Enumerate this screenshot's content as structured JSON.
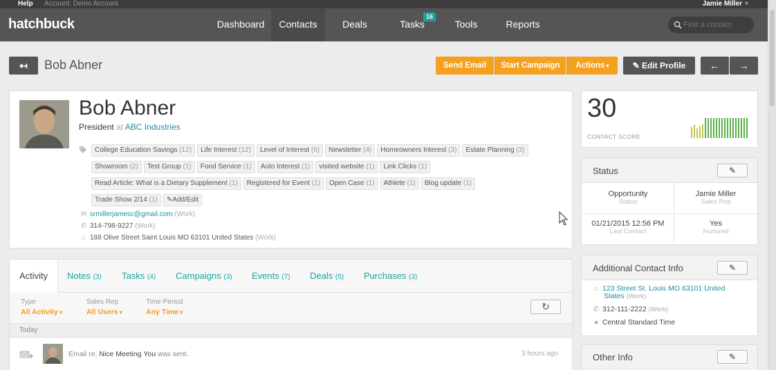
{
  "topbar": {
    "help": "Help",
    "account": "Account: Demo Account",
    "user": "Jamie Miller"
  },
  "app": {
    "logo": "hatchbuck"
  },
  "nav": {
    "items": [
      {
        "label": "Dashboard"
      },
      {
        "label": "Contacts"
      },
      {
        "label": "Deals"
      },
      {
        "label": "Tasks",
        "badge": "16"
      },
      {
        "label": "Tools"
      },
      {
        "label": "Reports"
      }
    ],
    "search_placeholder": "Find a contact"
  },
  "header": {
    "title": "Bob Abner",
    "send_email": "Send Email",
    "start_campaign": "Start Campaign",
    "actions": "Actions",
    "edit_profile": "Edit Profile"
  },
  "profile": {
    "name": "Bob Abner",
    "role": "President",
    "at": "at",
    "company": "ABC Industries",
    "tags": [
      {
        "label": "College Education Savings",
        "count": "(12)"
      },
      {
        "label": "Life Interest",
        "count": "(12)"
      },
      {
        "label": "Level of Interest",
        "count": "(6)"
      },
      {
        "label": "Newsletter",
        "count": "(4)"
      },
      {
        "label": "Homeowners Interest",
        "count": "(3)"
      },
      {
        "label": "Estate Planning",
        "count": "(3)"
      },
      {
        "label": "Showroom",
        "count": "(2)"
      },
      {
        "label": "Test Group",
        "count": "(1)"
      },
      {
        "label": "Food Service",
        "count": "(1)"
      },
      {
        "label": "Auto Interest",
        "count": "(1)"
      },
      {
        "label": "visited website",
        "count": "(1)"
      },
      {
        "label": "Link Clicks",
        "count": "(1)"
      },
      {
        "label": "Read Article: What is a Dietary Supplement",
        "count": "(1)"
      },
      {
        "label": "Registered for Event",
        "count": "(1)"
      },
      {
        "label": "Open Case",
        "count": "(1)"
      },
      {
        "label": "Athlete",
        "count": "(1)"
      },
      {
        "label": "Blog update",
        "count": "(1)"
      },
      {
        "label": "Trade Show 2/14",
        "count": "(1)"
      }
    ],
    "add_edit": "Add/Edit",
    "email": "srmillerjamesc@gmail.com",
    "email_type": "(Work)",
    "phone": "314-798-9227",
    "phone_type": "(Work)",
    "address": "188 Olive Street Saint Louis MO 63101 United States",
    "address_type": "(Work)"
  },
  "activity": {
    "tabs": [
      {
        "label": "Activity",
        "count": ""
      },
      {
        "label": "Notes",
        "count": "(3)"
      },
      {
        "label": "Tasks",
        "count": "(4)"
      },
      {
        "label": "Campaigns",
        "count": "(3)"
      },
      {
        "label": "Events",
        "count": "(7)"
      },
      {
        "label": "Deals",
        "count": "(5)"
      },
      {
        "label": "Purchases",
        "count": "(3)"
      }
    ],
    "filters": {
      "type_label": "Type",
      "type_value": "All Activity",
      "rep_label": "Sales Rep",
      "rep_value": "All Users",
      "period_label": "Time Period",
      "period_value": "Any Time"
    },
    "day": "Today",
    "item": {
      "prefix": "Email re:",
      "subject": "Nice Meeting You",
      "suffix": "was sent.",
      "time": "3 hours ago"
    }
  },
  "score": {
    "value": "30",
    "label": "CONTACT SCORE"
  },
  "status": {
    "title": "Status",
    "stage": "Opportunity",
    "stage_label": "Status",
    "rep": "Jamie Miller",
    "rep_label": "Sales Rep",
    "last_contact": "01/21/2015 12:56 PM",
    "last_contact_label": "Last Contact",
    "nurtured": "Yes",
    "nurtured_label": "Nurtured"
  },
  "additional": {
    "title": "Additional Contact Info",
    "address_line1": "123 Street St. Louis MO 63101 United",
    "address_line2": "States",
    "address_type": "(Work)",
    "phone": "312-111-2222",
    "phone_type": "(Work)",
    "timezone": "Central Standard Time"
  },
  "other": {
    "title": "Other Info"
  },
  "colors": {
    "accent": "#1aa3a3",
    "orange": "#f4a11f",
    "nav": "#555555"
  }
}
